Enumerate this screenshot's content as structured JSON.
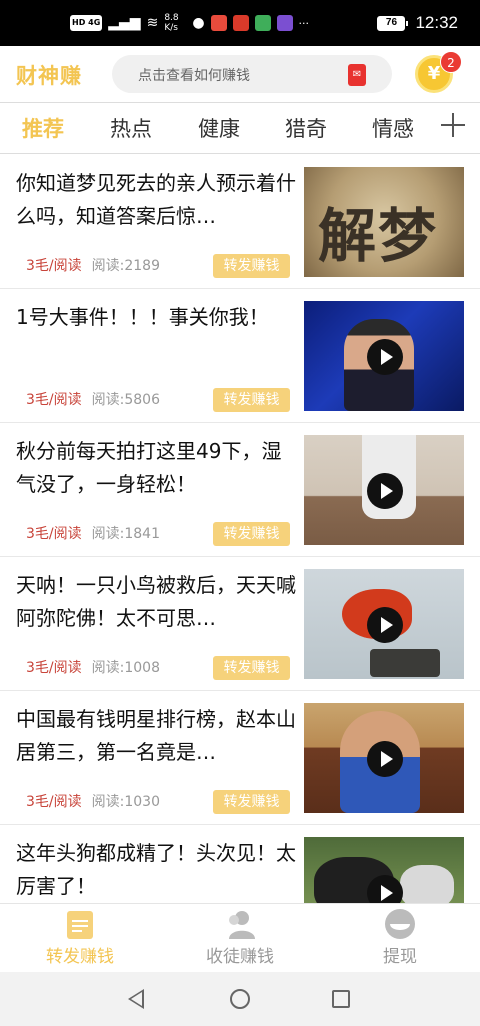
{
  "status_bar": {
    "left_text": "HD 4G",
    "speed": "8.8 K/s",
    "battery": "76",
    "time": "12:32"
  },
  "header": {
    "logo": "财神赚",
    "search_placeholder": "点击查看如何赚钱",
    "coin_symbol": "¥",
    "coin_badge": "2"
  },
  "tabs": [
    {
      "label": "推荐",
      "active": true
    },
    {
      "label": "热点",
      "active": false
    },
    {
      "label": "健康",
      "active": false
    },
    {
      "label": "猎奇",
      "active": false
    },
    {
      "label": "情感",
      "active": false
    }
  ],
  "feed": [
    {
      "title": "你知道梦见死去的亲人预示着什么吗，知道答案后惊…",
      "price": "3毛/阅读",
      "reads": "阅读:2189",
      "share": "转发赚钱",
      "thumb_text": "解梦",
      "video": false
    },
    {
      "title": "1号大事件！！！事关你我！",
      "price": "3毛/阅读",
      "reads": "阅读:5806",
      "share": "转发赚钱",
      "video": true
    },
    {
      "title": "秋分前每天拍打这里49下，湿气没了，一身轻松！",
      "price": "3毛/阅读",
      "reads": "阅读:1841",
      "share": "转发赚钱",
      "video": true
    },
    {
      "title": "天呐！一只小鸟被救后，天天喊阿弥陀佛！太不可思…",
      "price": "3毛/阅读",
      "reads": "阅读:1008",
      "share": "转发赚钱",
      "video": true
    },
    {
      "title": "中国最有钱明星排行榜，赵本山居第三，第一名竟是…",
      "price": "3毛/阅读",
      "reads": "阅读:1030",
      "share": "转发赚钱",
      "video": true
    },
    {
      "title": "这年头狗都成精了！头次见！太厉害了！",
      "price": "",
      "reads": "",
      "share": "",
      "video": true
    }
  ],
  "bottom_nav": [
    {
      "label": "转发赚钱",
      "active": true
    },
    {
      "label": "收徒赚钱",
      "active": false
    },
    {
      "label": "提现",
      "active": false
    }
  ],
  "colors": {
    "accent": "#f3c552",
    "price_red": "#c8443a"
  }
}
